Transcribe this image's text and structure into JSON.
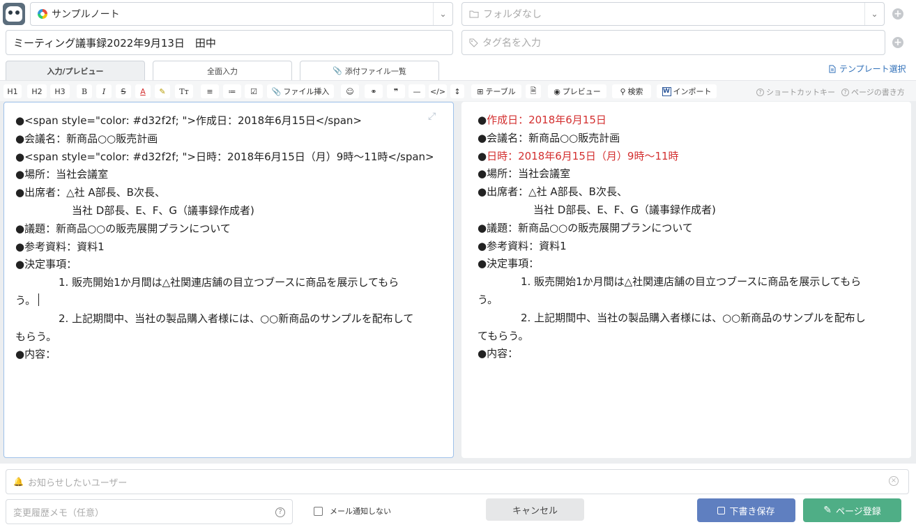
{
  "header": {
    "notebook": {
      "label": "サンプルノート",
      "icon": "ring-icon"
    },
    "folder": {
      "placeholder": "フォルダなし",
      "icon": "folder-icon"
    },
    "title": "ミーティング議事録2022年9月13日　田中",
    "tag_placeholder": "タグ名を入力"
  },
  "tabs": [
    {
      "label": "入力/プレビュー",
      "active": true
    },
    {
      "label": "全面入力",
      "active": false
    },
    {
      "label": "添付ファイル一覧",
      "active": false
    }
  ],
  "template_link": "テンプレート選択",
  "toolbar": {
    "h1": "H1",
    "h2": "H2",
    "h3": "H3",
    "bold": "B",
    "italic": "I",
    "strike": "S",
    "color": "A",
    "highlight": "✎",
    "size": "Tт",
    "file_insert": "ファイル挿入",
    "quote": "❞",
    "hr": "—",
    "code": "</>",
    "height": "↕",
    "table": "テーブル",
    "preview": "プレビュー",
    "search": "検索",
    "import": "インポート",
    "shortcut": "ショートカットキー",
    "howto": "ページの書き方"
  },
  "editor": {
    "lines": [
      "●<span style=\"color: #d32f2f; \">作成日：2018年6月15日</span>",
      "●会議名：新商品○○販売計画",
      "●<span style=\"color: #d32f2f; \">日時：2018年6月15日（月）9時〜11時</span>",
      "●場所：当社会議室",
      "●出席者：△社 A部長、B次長、",
      "当社 D部長、E、F、G（議事録作成者)",
      "●議題：新商品○○の販売展開プランについて",
      "●参考資料：資料1",
      "●決定事項：",
      "1.  販売開始1か月間は△社関連店舗の目立つブースに商品を展示してもら",
      "う。",
      "2.  上記期間中、当社の製品購入者様には、○○新商品のサンプルを配布して",
      "もらう。",
      "●内容："
    ]
  },
  "preview": {
    "created_bullet": "●",
    "created": "作成日：2018年6月15日",
    "meeting_name": "●会議名：新商品○○販売計画",
    "datetime_bullet": "●",
    "datetime": "日時：2018年6月15日（月）9時〜11時",
    "place": "●場所：当社会議室",
    "attendees1": "●出席者：△社 A部長、B次長、",
    "attendees2": "当社 D部長、E、F、G（議事録作成者)",
    "agenda": "●議題：新商品○○の販売展開プランについて",
    "reference": "●参考資料：資料1",
    "decisions": "●決定事項：",
    "item1": "1.  販売開始1か月間は△社関連店舗の目立つブースに商品を展示してもら",
    "item1b": "う。",
    "item2": "2.  上記期間中、当社の製品購入者様には、○○新商品のサンプルを配布し",
    "item2b": "てもらう。",
    "content": "●内容："
  },
  "bottom": {
    "notify_placeholder": "お知らせしたいユーザー",
    "memo_placeholder": "変更履歴メモ（任意）",
    "no_mail_label": "メール通知しない",
    "cancel": "キャンセル",
    "draft": "下書き保存",
    "register": "ページ登録"
  },
  "colors": {
    "accent_red": "#d32f2f",
    "draft": "#5f7fc0",
    "register": "#4fae86",
    "link": "#2f6fb8"
  }
}
